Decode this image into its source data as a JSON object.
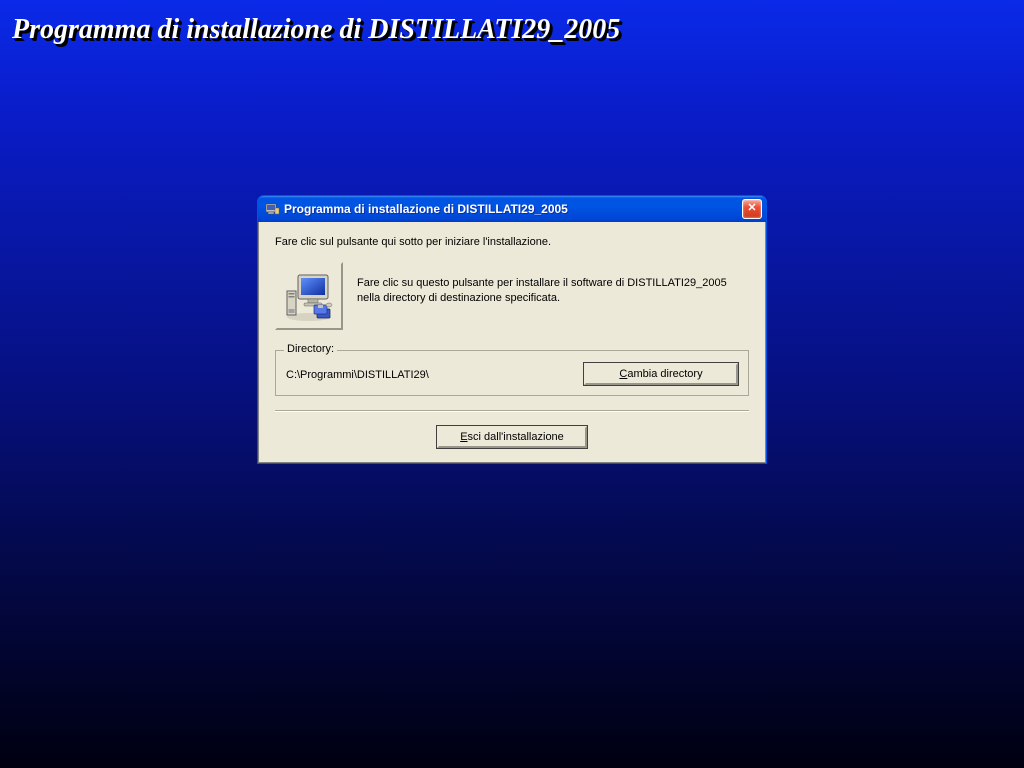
{
  "desktop": {
    "title": "Programma di installazione di DISTILLATI29_2005"
  },
  "dialog": {
    "title": "Programma di installazione di DISTILLATI29_2005",
    "instruction": "Fare clic sul pulsante qui sotto per iniziare l'installazione.",
    "install_description": "Fare clic su questo pulsante per installare il software di DISTILLATI29_2005 nella directory di destinazione specificata.",
    "directory": {
      "label": "Directory:",
      "path": "C:\\Programmi\\DISTILLATI29\\",
      "change_button_pre": "",
      "change_button_hot": "C",
      "change_button_post": "ambia directory"
    },
    "exit_button_pre": "",
    "exit_button_hot": "E",
    "exit_button_post": "sci dall'installazione",
    "close_glyph": "✕"
  }
}
